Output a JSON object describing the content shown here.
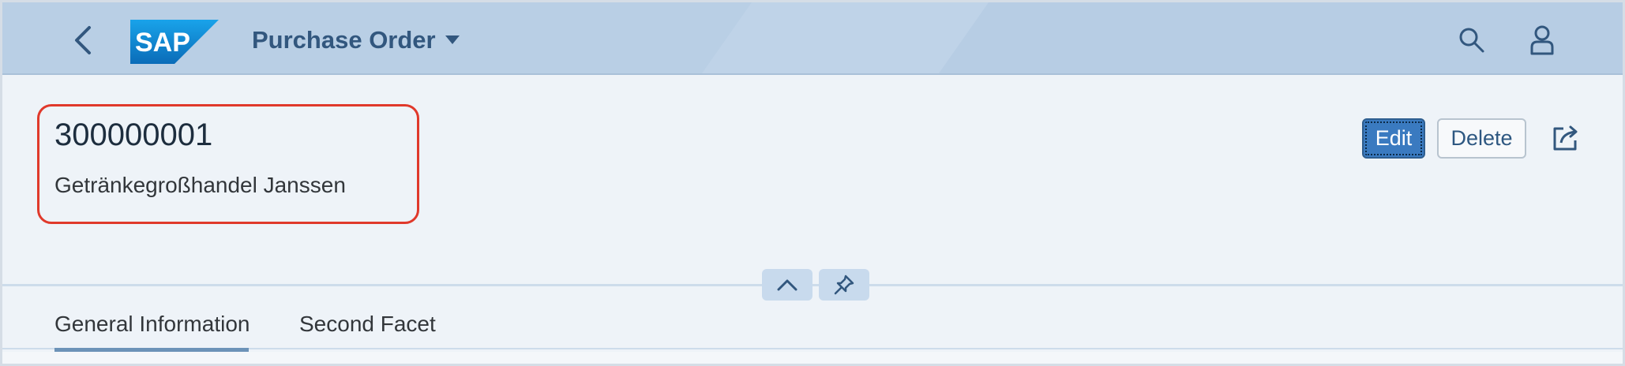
{
  "shell": {
    "app_title": "Purchase Order",
    "logo_text": "SAP",
    "icons": {
      "back": "back-chevron-icon",
      "title_menu": "caret-down-icon",
      "search": "search-icon",
      "user": "user-icon"
    }
  },
  "header": {
    "title": "300000001",
    "subtitle": "Getränkegroßhandel Janssen",
    "actions": {
      "edit_label": "Edit",
      "delete_label": "Delete",
      "share_icon": "share-icon"
    },
    "collapse_icon": "chevron-up-icon",
    "pin_icon": "pin-icon"
  },
  "tabs": [
    {
      "label": "General Information",
      "active": true
    },
    {
      "label": "Second Facet",
      "active": false
    }
  ],
  "colors": {
    "shell_background": "#b9cfe5",
    "brand_blue": "#32577e",
    "edit_button": "#3a7ac0",
    "highlight_box": "#e0392b"
  }
}
